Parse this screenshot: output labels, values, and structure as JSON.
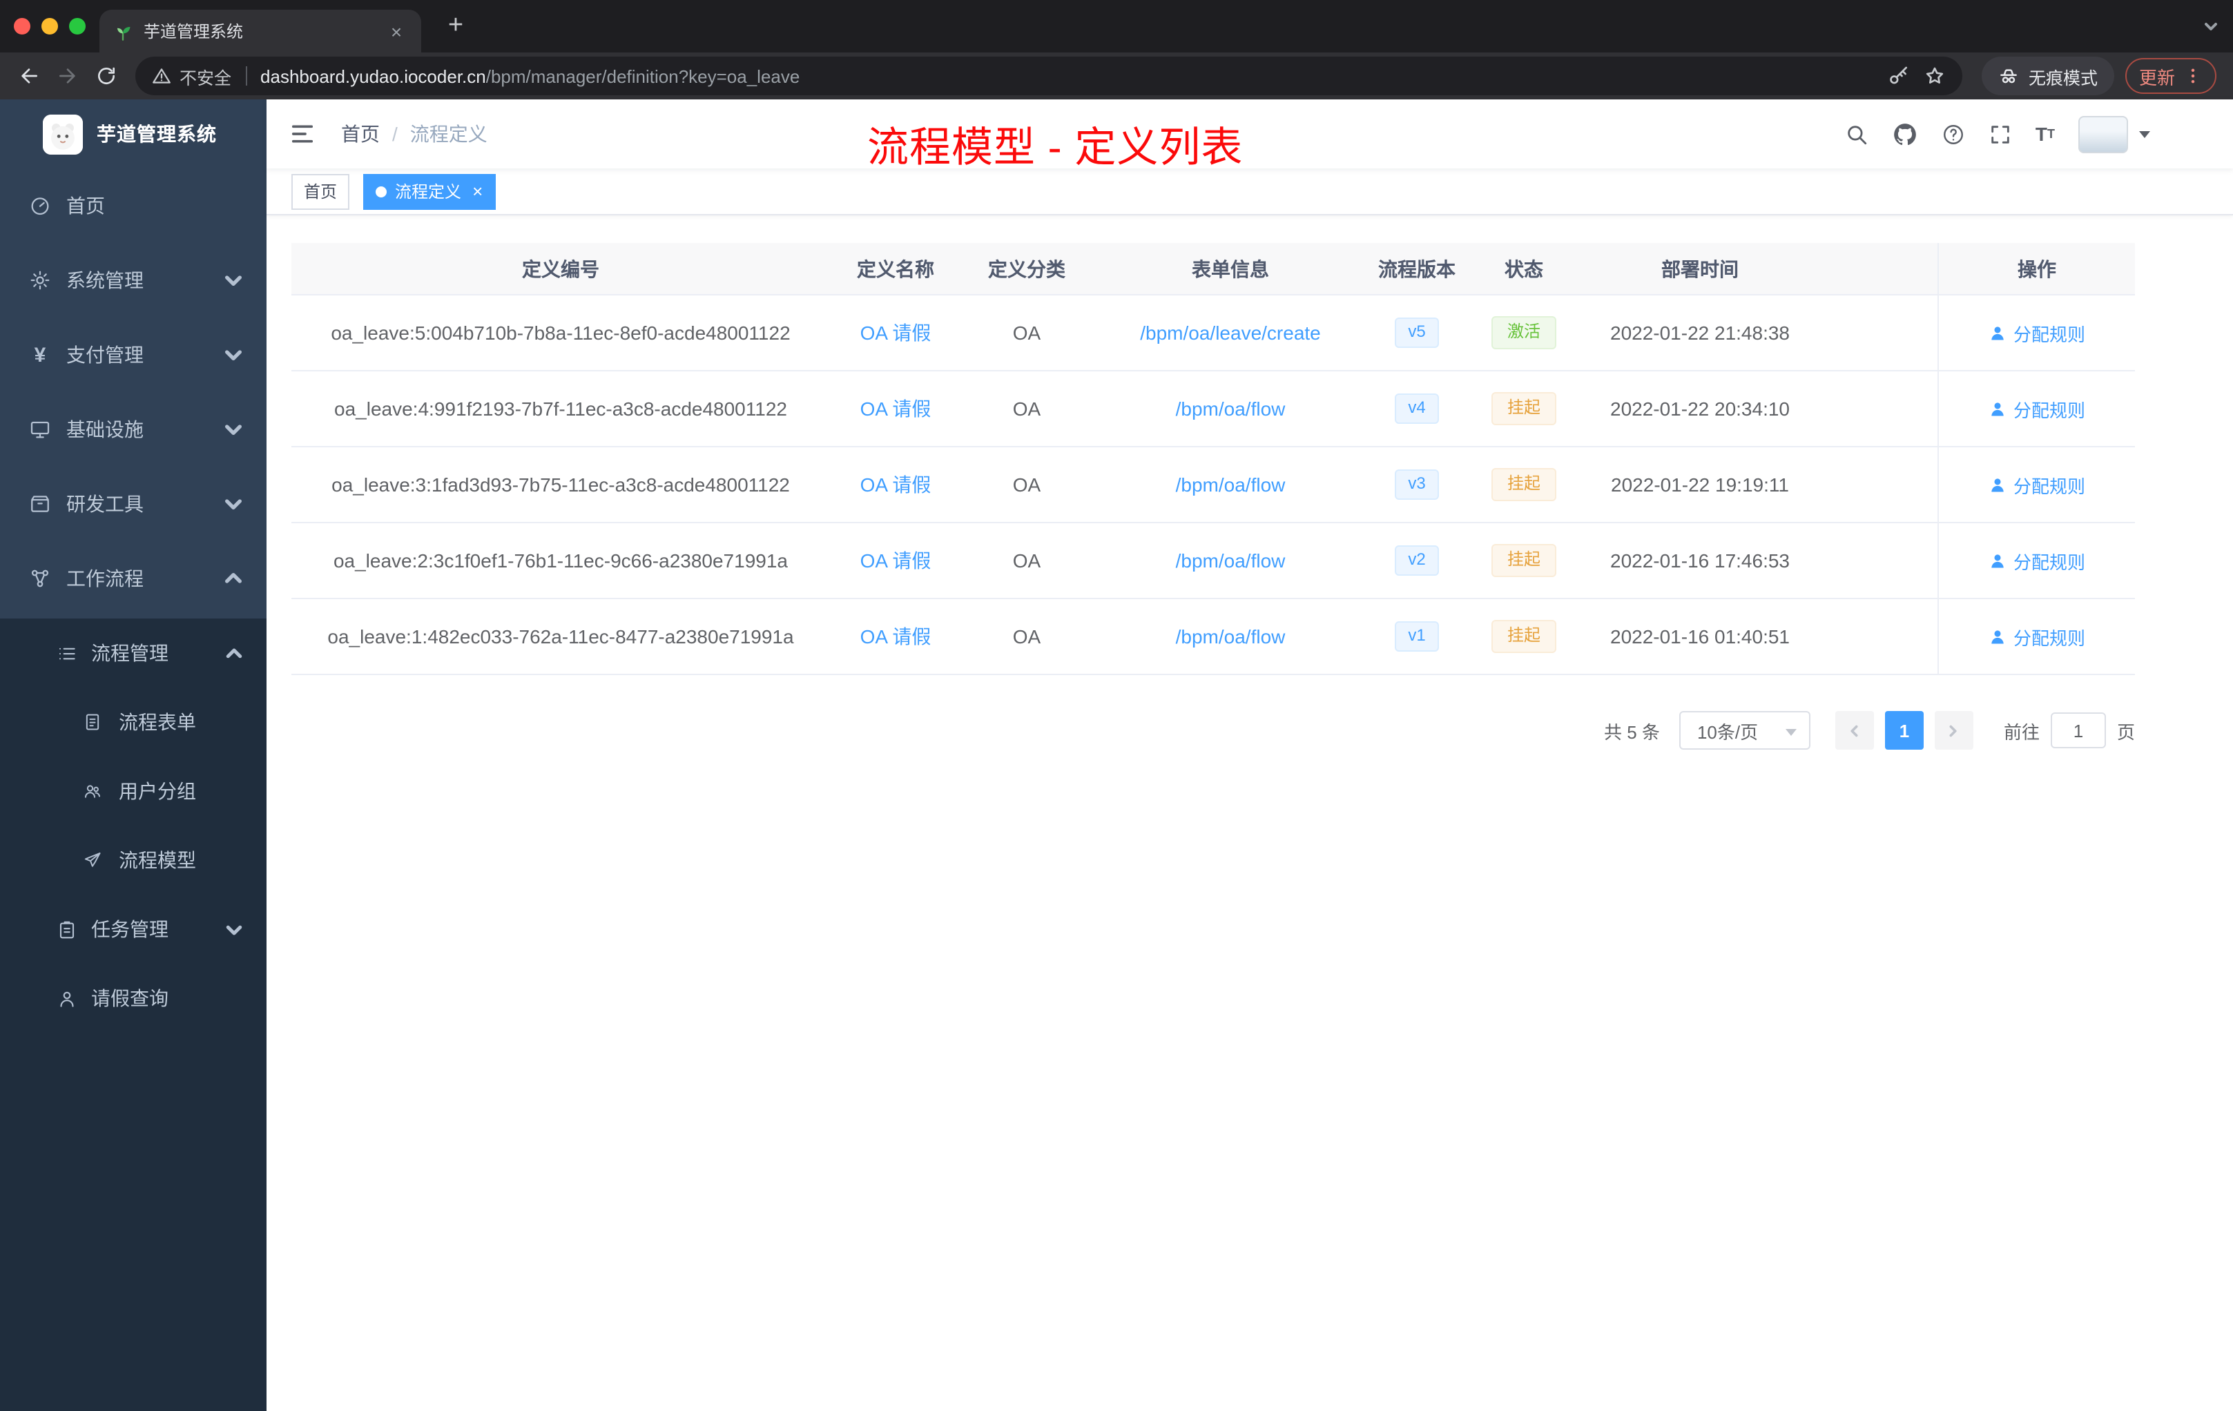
{
  "browser": {
    "tab": {
      "title": "芋道管理系统",
      "close_glyph": "×",
      "new_tab_glyph": "+"
    },
    "toolbar": {
      "security_label": "不安全",
      "url_host": "dashboard.yudao.iocoder.cn",
      "url_path": "/bpm/manager/definition?key=oa_leave",
      "incognito_label": "无痕模式",
      "update_label": "更新"
    }
  },
  "sidebar": {
    "logo_title": "芋道管理系统",
    "menu": [
      {
        "label": "首页",
        "icon": "dashboard-icon"
      },
      {
        "label": "系统管理",
        "icon": "gear-icon",
        "icon_glyph": ""
      },
      {
        "label": "支付管理",
        "icon": "yen-icon",
        "icon_glyph": "¥"
      },
      {
        "label": "基础设施",
        "icon": "infrastructure-icon"
      },
      {
        "label": "研发工具",
        "icon": "devtools-icon"
      },
      {
        "label": "工作流程",
        "icon": "workflow-icon"
      }
    ],
    "submenu": [
      {
        "label": "流程管理",
        "icon": "process-management-icon",
        "level": 1
      },
      {
        "label": "流程表单",
        "icon": "process-form-icon",
        "level": 2
      },
      {
        "label": "用户分组",
        "icon": "user-group-icon",
        "level": 2
      },
      {
        "label": "流程模型",
        "icon": "process-model-icon",
        "level": 2
      },
      {
        "label": "任务管理",
        "icon": "task-management-icon",
        "level": 1
      },
      {
        "label": "请假查询",
        "icon": "leave-query-icon",
        "level": 1
      }
    ]
  },
  "header": {
    "breadcrumb_home": "首页",
    "breadcrumb_sep": "/",
    "breadcrumb_current": "流程定义",
    "font_icon_big": "T",
    "font_icon_small": "T"
  },
  "annotation": "流程模型 - 定义列表",
  "tags": [
    {
      "label": "首页",
      "active": false
    },
    {
      "label": "流程定义",
      "active": true
    }
  ],
  "table": {
    "columns": [
      "定义编号",
      "定义名称",
      "定义分类",
      "表单信息",
      "流程版本",
      "状态",
      "部署时间",
      "操作"
    ],
    "rows": [
      {
        "id": "oa_leave:5:004b710b-7b8a-11ec-8ef0-acde48001122",
        "name": "OA 请假",
        "category": "OA",
        "form": "/bpm/oa/leave/create",
        "version": "v5",
        "status": "激活",
        "status_type": "success",
        "time": "2022-01-22 21:48:38",
        "action": "分配规则"
      },
      {
        "id": "oa_leave:4:991f2193-7b7f-11ec-a3c8-acde48001122",
        "name": "OA 请假",
        "category": "OA",
        "form": "/bpm/oa/flow",
        "version": "v4",
        "status": "挂起",
        "status_type": "warning",
        "time": "2022-01-22 20:34:10",
        "action": "分配规则"
      },
      {
        "id": "oa_leave:3:1fad3d93-7b75-11ec-a3c8-acde48001122",
        "name": "OA 请假",
        "category": "OA",
        "form": "/bpm/oa/flow",
        "version": "v3",
        "status": "挂起",
        "status_type": "warning",
        "time": "2022-01-22 19:19:11",
        "action": "分配规则"
      },
      {
        "id": "oa_leave:2:3c1f0ef1-76b1-11ec-9c66-a2380e71991a",
        "name": "OA 请假",
        "category": "OA",
        "form": "/bpm/oa/flow",
        "version": "v2",
        "status": "挂起",
        "status_type": "warning",
        "time": "2022-01-16 17:46:53",
        "action": "分配规则"
      },
      {
        "id": "oa_leave:1:482ec033-762a-11ec-8477-a2380e71991a",
        "name": "OA 请假",
        "category": "OA",
        "form": "/bpm/oa/flow",
        "version": "v1",
        "status": "挂起",
        "status_type": "warning",
        "time": "2022-01-16 01:40:51",
        "action": "分配规则"
      }
    ]
  },
  "pagination": {
    "total": "共 5 条",
    "page_size": "10条/页",
    "page": "1",
    "goto_label": "前往",
    "goto_value": "1",
    "unit_label": "页"
  },
  "colors": {
    "accent": "#409eff",
    "success": "#67c23a",
    "warning": "#e6a23c",
    "sidebar_bg": "#304156",
    "sidebar_submenu_bg": "#1f2d3d",
    "annotation_red": "#fb0a0a"
  }
}
